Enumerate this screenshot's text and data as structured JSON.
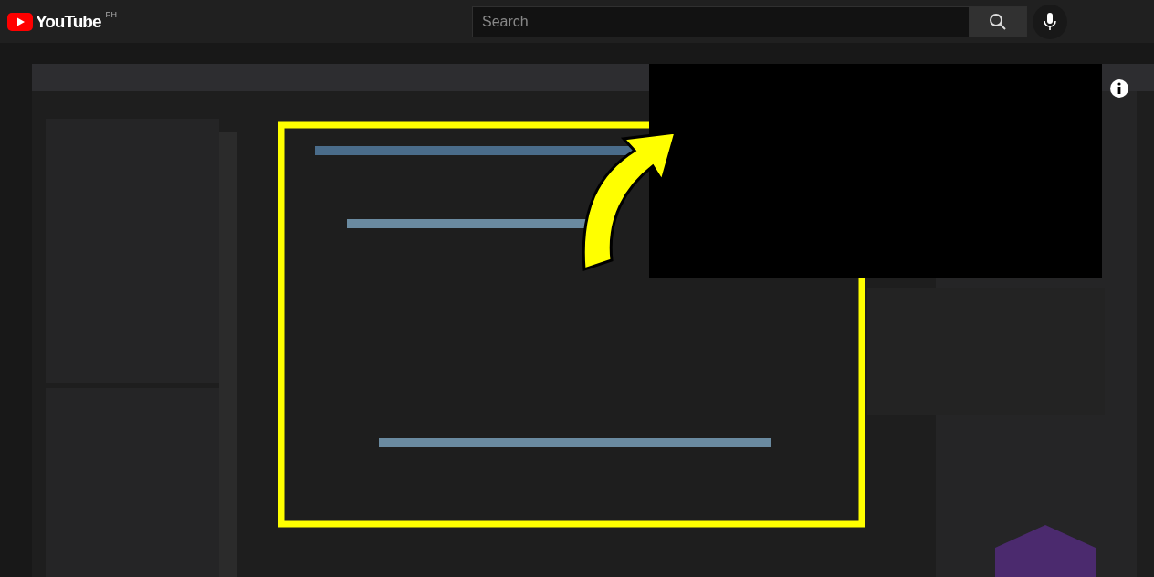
{
  "header": {
    "logo": "YouTube",
    "country": "PH",
    "search": {
      "placeholder": "Search"
    }
  }
}
